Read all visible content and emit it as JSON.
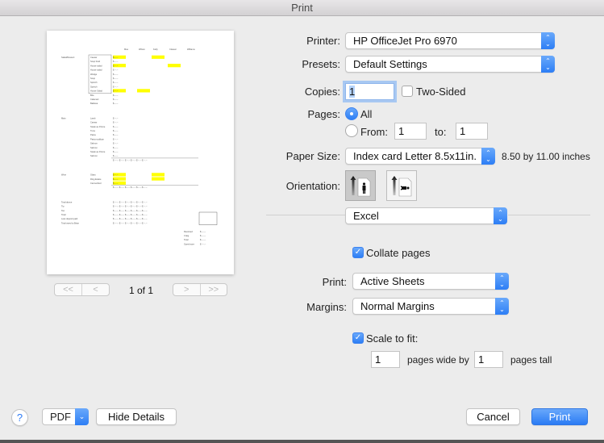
{
  "window": {
    "title": "Print"
  },
  "preview": {
    "page_indicator": "1 of 1",
    "nav": {
      "first": "<<",
      "prev": "<",
      "next": ">",
      "last": ">>"
    },
    "sheet": {
      "headers": [
        "Moe",
        "Wilson",
        "Kelly",
        "Cleaver",
        "Williams"
      ],
      "sections": [
        {
          "name": "Salad/Dessert",
          "items": [
            "Caesar",
            "Soup bowl",
            "House salad",
            "House salad",
            "Wedge",
            "Soup",
            "Spinich",
            "Spinich",
            "House Salad",
            "Brie",
            "Calamari",
            "Baklava"
          ]
        },
        {
          "name": "Main",
          "items": [
            "Lamb",
            "Caesar",
            "Steak au Poivre",
            "Tuna",
            "Pasta",
            "Pasta scallops",
            "Salmon",
            "Salmon",
            "Steak au Poivre",
            "Salmon"
          ]
        },
        {
          "name": "Wine",
          "items": [
            "Glass",
            "Ring Estate",
            "Carmenfied"
          ]
        }
      ],
      "totals_labels": [
        "Total above",
        "Tip",
        "Tax",
        "Total",
        "Less deposit paid",
        "Total owed to Brian"
      ],
      "summary_labels": [
        "Received",
        "Craig",
        "Total",
        "Open/more"
      ]
    }
  },
  "form": {
    "printer": {
      "label": "Printer:",
      "value": "HP OfficeJet Pro 6970"
    },
    "presets": {
      "label": "Presets:",
      "value": "Default Settings"
    },
    "copies": {
      "label": "Copies:",
      "value": "1"
    },
    "two_sided": {
      "label": "Two-Sided",
      "checked": false
    },
    "pages": {
      "label": "Pages:",
      "all_label": "All",
      "all_selected": true,
      "from_label": "From:",
      "from_value": "1",
      "to_label": "to:",
      "to_value": "1"
    },
    "paper_size": {
      "label": "Paper Size:",
      "value": "Index card Letter 8.5x11in.",
      "dimensions": "8.50 by 11.00 inches"
    },
    "orientation": {
      "label": "Orientation:",
      "options": [
        "portrait",
        "landscape"
      ],
      "selected": "portrait"
    },
    "app_section": {
      "value": "Excel"
    },
    "collate": {
      "label": "Collate pages",
      "checked": true
    },
    "print_what": {
      "label": "Print:",
      "value": "Active Sheets"
    },
    "margins": {
      "label": "Margins:",
      "value": "Normal Margins"
    },
    "scale_to_fit": {
      "label": "Scale to fit:",
      "checked": true,
      "wide_value": "1",
      "wide_label": "pages wide by",
      "tall_value": "1",
      "tall_label": "pages tall"
    }
  },
  "footer": {
    "help": "?",
    "pdf": "PDF",
    "hide_details": "Hide Details",
    "cancel": "Cancel",
    "print": "Print"
  },
  "colors": {
    "accent": "#2d7ef5",
    "highlight": "#ffff00"
  }
}
